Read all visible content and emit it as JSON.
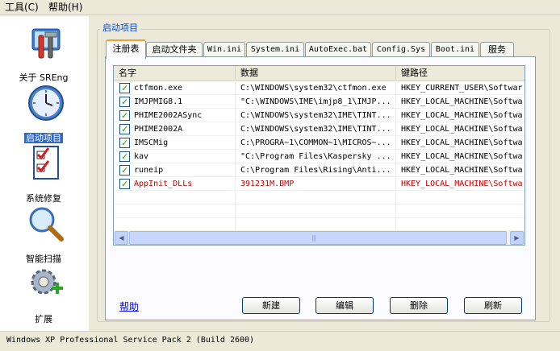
{
  "menu": [
    "工具(C)",
    "帮助(H)"
  ],
  "nav": [
    {
      "label": "关于 SREng",
      "icon": "tools-icon"
    },
    {
      "label": "启动项目",
      "icon": "clock-icon"
    },
    {
      "label": "系统修复",
      "icon": "checklist-icon"
    },
    {
      "label": "智能扫描",
      "icon": "magnifier-icon"
    },
    {
      "label": "扩展",
      "icon": "gear-plus-icon"
    }
  ],
  "group_title": "启动项目",
  "tabs": [
    "注册表",
    "启动文件夹",
    "Win.ini",
    "System.ini",
    "AutoExec.bat",
    "Config.Sys",
    "Boot.ini",
    "服务"
  ],
  "columns": [
    "名字",
    "数据",
    "键路径"
  ],
  "rows": [
    {
      "name": "ctfmon.exe",
      "data": "C:\\WINDOWS\\system32\\ctfmon.exe",
      "key": "HKEY_CURRENT_USER\\Softwar",
      "checked": true
    },
    {
      "name": "IMJPMIG8.1",
      "data": "\"C:\\WINDOWS\\IME\\imjp8_1\\IMJP...",
      "key": "HKEY_LOCAL_MACHINE\\Softwa",
      "checked": true
    },
    {
      "name": "PHIME2002ASync",
      "data": "C:\\WINDOWS\\system32\\IME\\TINT...",
      "key": "HKEY_LOCAL_MACHINE\\Softwa",
      "checked": true
    },
    {
      "name": "PHIME2002A",
      "data": "C:\\WINDOWS\\system32\\IME\\TINT...",
      "key": "HKEY_LOCAL_MACHINE\\Softwa",
      "checked": true
    },
    {
      "name": "IMSCMig",
      "data": "C:\\PROGRA~1\\COMMON~1\\MICROS~...",
      "key": "HKEY_LOCAL_MACHINE\\Softwa",
      "checked": true
    },
    {
      "name": "kav",
      "data": "\"C:\\Program Files\\Kaspersky ...",
      "key": "HKEY_LOCAL_MACHINE\\Softwa",
      "checked": true
    },
    {
      "name": "runeip",
      "data": "C:\\Program Files\\Rising\\Anti...",
      "key": "HKEY_LOCAL_MACHINE\\Softwa",
      "checked": true
    },
    {
      "name": "AppInit_DLLs",
      "data": "391231M.BMP",
      "key": "HKEY_LOCAL_MACHINE\\Softwa",
      "checked": true,
      "highlight": true
    }
  ],
  "help_label": "帮助",
  "buttons": [
    "新建",
    "编辑",
    "删除",
    "刷新"
  ],
  "status": "Windows XP Professional Service Pack 2 (Build 2600)",
  "colors": {
    "accent_tab": "#f1a12b",
    "group_title": "#0046d5",
    "highlight_row": "#c00000",
    "nav_selected": "#316ac5"
  }
}
